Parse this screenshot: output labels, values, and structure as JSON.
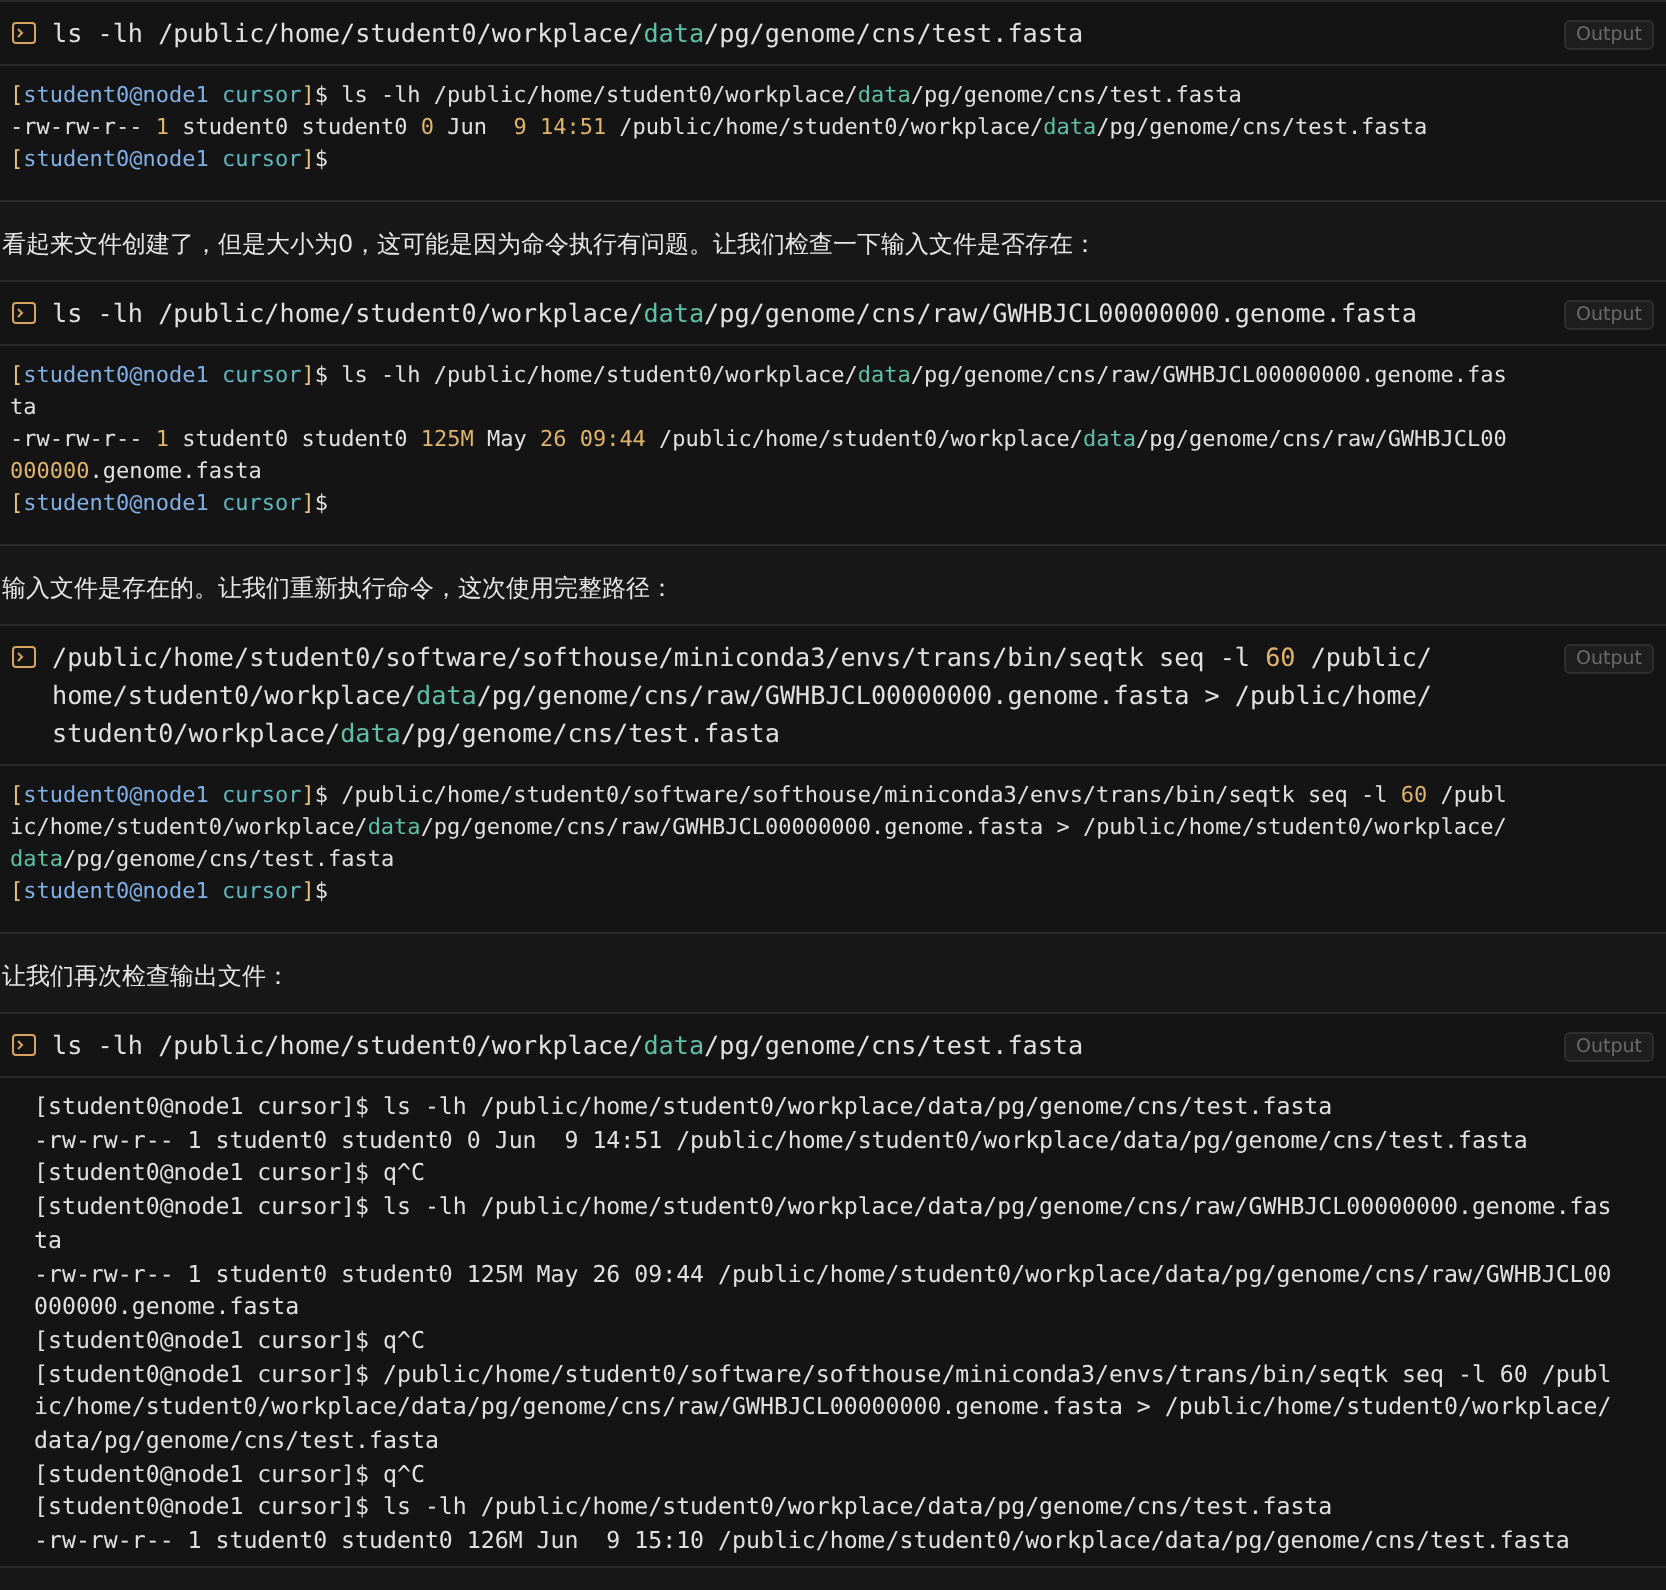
{
  "items": [
    {
      "kind": "command",
      "badge": "Output",
      "command": [
        [
          {
            "text": "ls -lh /public/home/student0/workplace/",
            "kind": "plain"
          },
          {
            "text": "data",
            "kind": "highlight"
          },
          {
            "text": "/pg/genome/cns/test.fasta",
            "kind": "plain"
          }
        ]
      ],
      "output": {
        "kind": "colored",
        "lines": [
          [
            {
              "text": "[",
              "kind": "bracket"
            },
            {
              "text": "student0@node1",
              "kind": "user"
            },
            {
              "text": " cursor",
              "kind": "dir"
            },
            {
              "text": "]",
              "kind": "bracket"
            },
            {
              "text": "$ ls -lh /public/home/student0/workplace/",
              "kind": "plain"
            },
            {
              "text": "data",
              "kind": "highlight"
            },
            {
              "text": "/pg/genome/cns/test.fasta",
              "kind": "plain"
            }
          ],
          [
            {
              "text": "-rw-rw-r-- ",
              "kind": "plain"
            },
            {
              "text": "1",
              "kind": "number"
            },
            {
              "text": " student0 student0 ",
              "kind": "plain"
            },
            {
              "text": "0",
              "kind": "number"
            },
            {
              "text": " Jun  ",
              "kind": "plain"
            },
            {
              "text": "9 14:51",
              "kind": "number"
            },
            {
              "text": " /public/home/student0/workplace/",
              "kind": "plain"
            },
            {
              "text": "data",
              "kind": "highlight"
            },
            {
              "text": "/pg/genome/cns/test.fasta",
              "kind": "plain"
            }
          ],
          [
            {
              "text": "[",
              "kind": "bracket"
            },
            {
              "text": "student0@node1",
              "kind": "user"
            },
            {
              "text": " cursor",
              "kind": "dir"
            },
            {
              "text": "]",
              "kind": "bracket"
            },
            {
              "text": "$",
              "kind": "plain"
            }
          ]
        ]
      }
    },
    {
      "kind": "message",
      "text": "看起来文件创建了，但是大小为0，这可能是因为命令执行有问题。让我们检查一下输入文件是否存在："
    },
    {
      "kind": "command",
      "badge": "Output",
      "command": [
        [
          {
            "text": "ls -lh /public/home/student0/workplace/",
            "kind": "plain"
          },
          {
            "text": "data",
            "kind": "highlight"
          },
          {
            "text": "/pg/genome/cns/raw/GWHBJCL00000000.genome.fasta",
            "kind": "plain"
          }
        ]
      ],
      "output": {
        "kind": "colored",
        "lines": [
          [
            {
              "text": "[",
              "kind": "bracket"
            },
            {
              "text": "student0@node1",
              "kind": "user"
            },
            {
              "text": " cursor",
              "kind": "dir"
            },
            {
              "text": "]",
              "kind": "bracket"
            },
            {
              "text": "$ ls -lh /public/home/student0/workplace/",
              "kind": "plain"
            },
            {
              "text": "data",
              "kind": "highlight"
            },
            {
              "text": "/pg/genome/cns/raw/GWHBJCL00000000.genome.fas",
              "kind": "plain"
            }
          ],
          [
            {
              "text": "ta",
              "kind": "plain"
            }
          ],
          [
            {
              "text": "-rw-rw-r-- ",
              "kind": "plain"
            },
            {
              "text": "1",
              "kind": "number"
            },
            {
              "text": " student0 student0 ",
              "kind": "plain"
            },
            {
              "text": "125M",
              "kind": "number"
            },
            {
              "text": " May ",
              "kind": "plain"
            },
            {
              "text": "26 09:44",
              "kind": "number"
            },
            {
              "text": " /public/home/student0/workplace/",
              "kind": "plain"
            },
            {
              "text": "data",
              "kind": "highlight"
            },
            {
              "text": "/pg/genome/cns/raw/GWHBJCL00",
              "kind": "plain"
            }
          ],
          [
            {
              "text": "000000",
              "kind": "number"
            },
            {
              "text": ".genome.fasta",
              "kind": "plain"
            }
          ],
          [
            {
              "text": "[",
              "kind": "bracket"
            },
            {
              "text": "student0@node1",
              "kind": "user"
            },
            {
              "text": " cursor",
              "kind": "dir"
            },
            {
              "text": "]",
              "kind": "bracket"
            },
            {
              "text": "$",
              "kind": "plain"
            }
          ]
        ]
      }
    },
    {
      "kind": "message",
      "text": "输入文件是存在的。让我们重新执行命令，这次使用完整路径："
    },
    {
      "kind": "command",
      "badge": "Output",
      "command": [
        [
          {
            "text": "/public/home/student0/software/softhouse/miniconda3/envs/trans/bin/seqtk seq -l ",
            "kind": "plain"
          },
          {
            "text": "60",
            "kind": "number"
          },
          {
            "text": " /public/",
            "kind": "plain"
          }
        ],
        [
          {
            "text": "home/student0/workplace/",
            "kind": "plain"
          },
          {
            "text": "data",
            "kind": "highlight"
          },
          {
            "text": "/pg/genome/cns/raw/GWHBJCL00000000.genome.fasta > /public/home/",
            "kind": "plain"
          }
        ],
        [
          {
            "text": "student0/workplace/",
            "kind": "plain"
          },
          {
            "text": "data",
            "kind": "highlight"
          },
          {
            "text": "/pg/genome/cns/test.fasta",
            "kind": "plain"
          }
        ]
      ],
      "output": {
        "kind": "colored",
        "lines": [
          [
            {
              "text": "[",
              "kind": "bracket"
            },
            {
              "text": "student0@node1",
              "kind": "user"
            },
            {
              "text": " cursor",
              "kind": "dir"
            },
            {
              "text": "]",
              "kind": "bracket"
            },
            {
              "text": "$ /public/home/student0/software/softhouse/miniconda3/envs/trans/bin/seqtk seq -l ",
              "kind": "plain"
            },
            {
              "text": "60",
              "kind": "number"
            },
            {
              "text": " /publ",
              "kind": "plain"
            }
          ],
          [
            {
              "text": "ic/home/student0/workplace/",
              "kind": "plain"
            },
            {
              "text": "data",
              "kind": "highlight"
            },
            {
              "text": "/pg/genome/cns/raw/GWHBJCL00000000.genome.fasta > /public/home/student0/workplace/",
              "kind": "plain"
            }
          ],
          [
            {
              "text": "data",
              "kind": "highlight"
            },
            {
              "text": "/pg/genome/cns/test.fasta",
              "kind": "plain"
            }
          ],
          [
            {
              "text": "[",
              "kind": "bracket"
            },
            {
              "text": "student0@node1",
              "kind": "user"
            },
            {
              "text": " cursor",
              "kind": "dir"
            },
            {
              "text": "]",
              "kind": "bracket"
            },
            {
              "text": "$",
              "kind": "plain"
            }
          ]
        ]
      }
    },
    {
      "kind": "message",
      "text": "让我们再次检查输出文件："
    },
    {
      "kind": "command",
      "badge": "Output",
      "command": [
        [
          {
            "text": "ls -lh /public/home/student0/workplace/",
            "kind": "plain"
          },
          {
            "text": "data",
            "kind": "highlight"
          },
          {
            "text": "/pg/genome/cns/test.fasta",
            "kind": "plain"
          }
        ]
      ],
      "output": {
        "kind": "raw",
        "lines": [
          [
            {
              "text": "[student0@node1 cursor]$ ls -lh /public/home/student0/workplace/data/pg/genome/cns/test.fasta",
              "kind": "plain"
            }
          ],
          [
            {
              "text": "-rw-rw-r-- 1 student0 student0 0 Jun  9 14:51 /public/home/student0/workplace/data/pg/genome/cns/test.fasta",
              "kind": "plain"
            }
          ],
          [
            {
              "text": "[student0@node1 cursor]$ q^C",
              "kind": "plain"
            }
          ],
          [
            {
              "text": "[student0@node1 cursor]$ ls -lh /public/home/student0/workplace/data/pg/genome/cns/raw/GWHBJCL00000000.genome.fas",
              "kind": "plain"
            }
          ],
          [
            {
              "text": "ta",
              "kind": "plain"
            }
          ],
          [
            {
              "text": "-rw-rw-r-- 1 student0 student0 125M May 26 09:44 /public/home/student0/workplace/data/pg/genome/cns/raw/GWHBJCL00",
              "kind": "plain"
            }
          ],
          [
            {
              "text": "000000.genome.fasta",
              "kind": "plain"
            }
          ],
          [
            {
              "text": "[student0@node1 cursor]$ q^C",
              "kind": "plain"
            }
          ],
          [
            {
              "text": "[student0@node1 cursor]$ /public/home/student0/software/softhouse/miniconda3/envs/trans/bin/seqtk seq -l 60 /publ",
              "kind": "plain"
            }
          ],
          [
            {
              "text": "ic/home/student0/workplace/data/pg/genome/cns/raw/GWHBJCL00000000.genome.fasta > /public/home/student0/workplace/",
              "kind": "plain"
            }
          ],
          [
            {
              "text": "data/pg/genome/cns/test.fasta",
              "kind": "plain"
            }
          ],
          [
            {
              "text": "[student0@node1 cursor]$ q^C",
              "kind": "plain"
            }
          ],
          [
            {
              "text": "[student0@node1 cursor]$ ls -lh /public/home/student0/workplace/data/pg/genome/cns/test.fasta",
              "kind": "plain"
            }
          ],
          [
            {
              "text": "-rw-rw-r-- 1 student0 student0 126M Jun  9 15:10 /public/home/student0/workplace/data/pg/genome/cns/test.fasta",
              "kind": "plain"
            }
          ]
        ]
      }
    }
  ]
}
